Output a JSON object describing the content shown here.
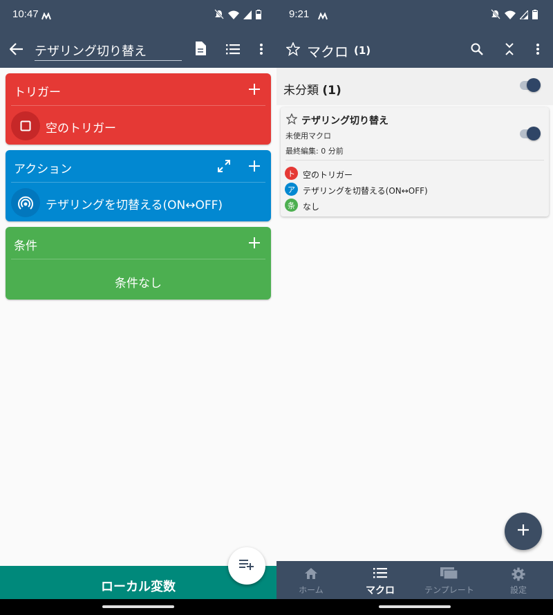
{
  "left": {
    "status": {
      "time": "10:47"
    },
    "appbar": {
      "title_value": "テザリング切り替え"
    },
    "trigger_card": {
      "title": "トリガー",
      "item": "空のトリガー",
      "color": "#e53935"
    },
    "action_card": {
      "title": "アクション",
      "item": "テザリングを切替える(ON↔OFF)",
      "color": "#0288d1"
    },
    "condition_card": {
      "title": "条件",
      "item": "条件なし",
      "color": "#4caf50"
    },
    "bottom_button": "ローカル変数"
  },
  "right": {
    "status": {
      "time": "9:21"
    },
    "appbar": {
      "title": "マクロ",
      "count": "(1)"
    },
    "category": {
      "name": "未分類",
      "count": "(1)"
    },
    "macro": {
      "name": "テザリング切り替え",
      "category": "未使用マクロ",
      "edited": "最終編集: 0 分前",
      "rows": [
        {
          "badge": "ト",
          "text": "空のトリガー",
          "color": "#e53935"
        },
        {
          "badge": "ア",
          "text": "テザリングを切替える(ON↔OFF)",
          "color": "#0288d1"
        },
        {
          "badge": "条",
          "text": "なし",
          "color": "#4caf50"
        }
      ]
    },
    "bottom_nav": [
      {
        "label": "ホーム",
        "icon": "home-icon"
      },
      {
        "label": "マクロ",
        "icon": "list-icon"
      },
      {
        "label": "テンプレート",
        "icon": "template-icon"
      },
      {
        "label": "設定",
        "icon": "gear-icon"
      }
    ],
    "active_tab": "マクロ"
  }
}
